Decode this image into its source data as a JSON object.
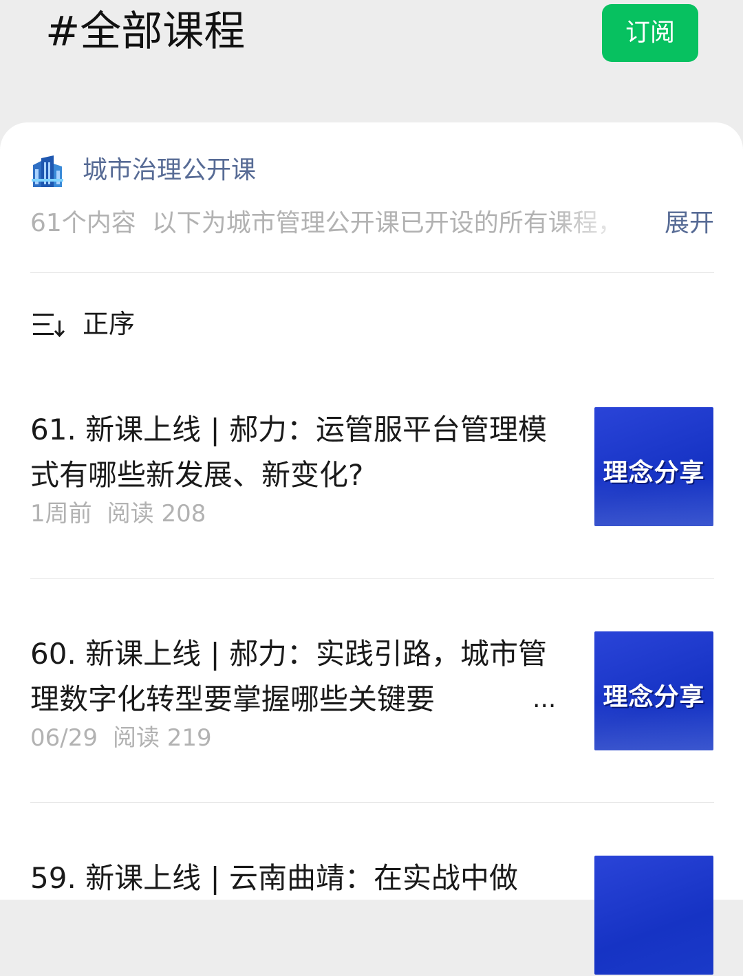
{
  "header": {
    "title": "#全部课程",
    "subscribe_label": "订阅"
  },
  "album": {
    "icon": "city-buildings-icon",
    "name": "城市治理公开课",
    "count": "61个内容",
    "description": "以下为城市管理公开课已开设的所有课程，",
    "expand_label": "展开"
  },
  "sort": {
    "icon": "sort-order-icon",
    "label": "正序"
  },
  "articles": [
    {
      "title": "61. 新课上线 | 郝力：运管服平台管理模式有哪些新发展、新变化?",
      "date": "1周前",
      "reads": "阅读 208",
      "thumb_text": "理念分享"
    },
    {
      "title": "60. 新课上线 | 郝力：实践引路，城市管理数字化转型要掌握哪些关键要",
      "ellipsis": "...",
      "date": "06/29",
      "reads": "阅读 219",
      "thumb_text": "理念分享"
    },
    {
      "title": "59. 新课上线 | 云南曲靖：在实战中做",
      "thumb_text": ""
    }
  ],
  "colors": {
    "accent_green": "#07c160",
    "link_blue": "#576b95",
    "thumb_blue": "#1a3ac8"
  }
}
